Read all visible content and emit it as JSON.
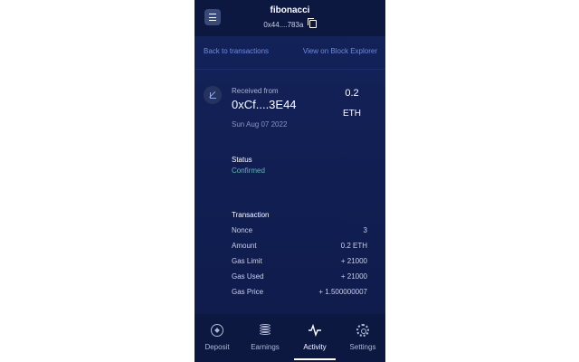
{
  "header": {
    "wallet_name": "fibonacci",
    "address_short": "0x44....783a",
    "menu_icon": "hamburger-icon",
    "copy_icon": "copy-icon"
  },
  "links": {
    "back": "Back to transactions",
    "explorer": "View on Block Explorer"
  },
  "transaction": {
    "direction_label": "Received from",
    "counterparty": "0xCf....3E44",
    "date": "Sun Aug 07 2022",
    "amount": "0.2",
    "currency": "ETH",
    "icon": "arrow-down-left-icon"
  },
  "status": {
    "title": "Status",
    "value": "Confirmed",
    "color": "#5fb8b2"
  },
  "details": {
    "title": "Transaction",
    "rows": [
      {
        "key": "Nonce",
        "value": "3"
      },
      {
        "key": "Amount",
        "value": "0.2 ETH"
      },
      {
        "key": "Gas Limit",
        "value": "+ 21000"
      },
      {
        "key": "Gas Used",
        "value": "+ 21000"
      },
      {
        "key": "Gas Price",
        "value": "+ 1.500000007"
      }
    ]
  },
  "tabs": [
    {
      "label": "Deposit",
      "icon": "compass-icon"
    },
    {
      "label": "Earnings",
      "icon": "coins-icon"
    },
    {
      "label": "Activity",
      "icon": "activity-icon",
      "active": true
    },
    {
      "label": "Settings",
      "icon": "gear-icon"
    }
  ],
  "colors": {
    "background": "#111e52",
    "link": "#6f8be0",
    "accent_status": "#5fb8b2"
  }
}
